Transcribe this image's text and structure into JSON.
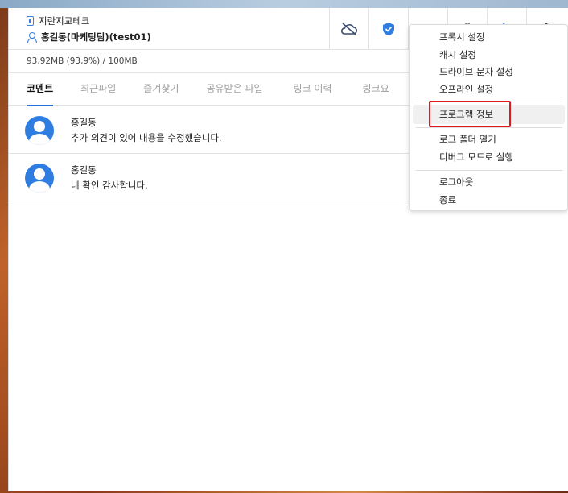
{
  "header": {
    "company": "지란지교테크",
    "user": "홍길동(마케팅팀)(test01)"
  },
  "storage": {
    "usage_text": "93,92MB (93,9%) / 100MB"
  },
  "toolbar": {
    "icons": [
      "cloud-offline-icon",
      "shield-icon",
      "folder-icon",
      "trash-icon",
      "sync-icon",
      "more-vert-icon"
    ],
    "accent": "#2a6fdb"
  },
  "tabs": [
    {
      "label": "코멘트",
      "active": true
    },
    {
      "label": "최근파일",
      "active": false
    },
    {
      "label": "즐겨찾기",
      "active": false
    },
    {
      "label": "공유받은 파일",
      "active": false
    },
    {
      "label": "링크 이력",
      "active": false
    },
    {
      "label": "링크요",
      "active": false
    }
  ],
  "comments": [
    {
      "author": "홍길동",
      "text": "추가 의견이 있어 내용을 수정했습니다."
    },
    {
      "author": "홍길동",
      "text": "네 확인 감사합니다."
    }
  ],
  "menu": {
    "items": [
      "프록시 설정",
      "캐시 설정",
      "드라이브 문자 설정",
      "오프라인 설정",
      "프로그램 정보",
      "로그 폴더 열기",
      "디버그 모드로 실행",
      "로그아웃",
      "종료"
    ],
    "highlighted": "프로그램 정보"
  }
}
